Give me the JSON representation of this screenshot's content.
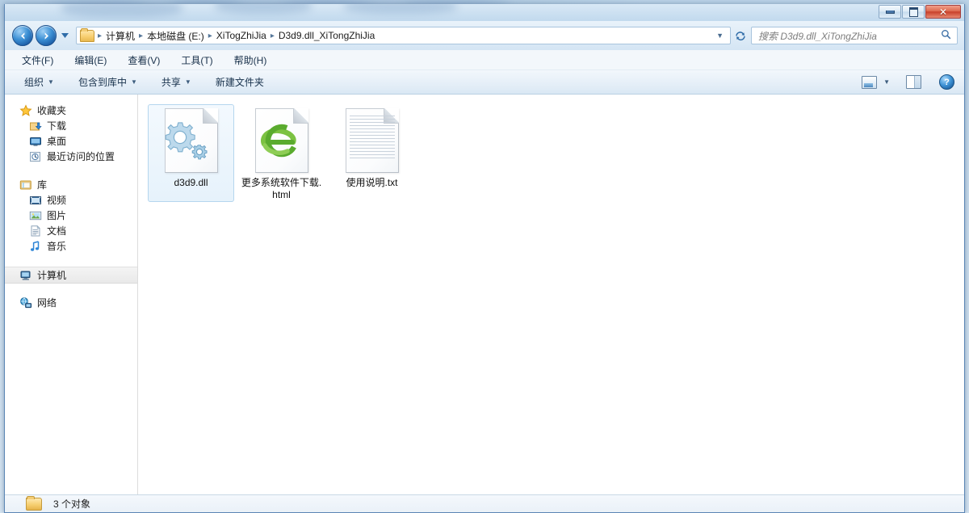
{
  "window": {
    "buttons": {
      "minimize": "minimize-button",
      "maximize": "maximize-button",
      "close": "✕"
    }
  },
  "nav": {
    "back_title": "后退",
    "forward_title": "前进",
    "breadcrumb": [
      "计算机",
      "本地磁盘 (E:)",
      "XiTogZhiJia",
      "D3d9.dll_XiTongZhiJia"
    ],
    "separator": "▸",
    "caret": "▼",
    "refresh_icon": "↻"
  },
  "search": {
    "placeholder": "搜索 D3d9.dll_XiTongZhiJia",
    "icon": "⌕"
  },
  "menu": {
    "items": [
      {
        "label": "文件(F)"
      },
      {
        "label": "编辑(E)"
      },
      {
        "label": "查看(V)"
      },
      {
        "label": "工具(T)"
      },
      {
        "label": "帮助(H)"
      }
    ]
  },
  "toolbar": {
    "items": [
      {
        "label": "组织",
        "caret": "▼"
      },
      {
        "label": "包含到库中",
        "caret": "▼"
      },
      {
        "label": "共享",
        "caret": "▼"
      },
      {
        "label": "新建文件夹",
        "caret": ""
      }
    ],
    "view_caret": "▼",
    "help_glyph": "?"
  },
  "sidebar": {
    "groups": [
      {
        "header": {
          "label": "收藏夹",
          "icon": "star-icon"
        },
        "items": [
          {
            "label": "下载",
            "icon": "downloads-icon"
          },
          {
            "label": "桌面",
            "icon": "desktop-icon"
          },
          {
            "label": "最近访问的位置",
            "icon": "recent-places-icon"
          }
        ]
      },
      {
        "header": {
          "label": "库",
          "icon": "libraries-icon"
        },
        "items": [
          {
            "label": "视频",
            "icon": "videos-icon"
          },
          {
            "label": "图片",
            "icon": "pictures-icon"
          },
          {
            "label": "文档",
            "icon": "documents-icon"
          },
          {
            "label": "音乐",
            "icon": "music-icon"
          }
        ]
      },
      {
        "header": {
          "label": "计算机",
          "icon": "computer-icon",
          "selected": true
        },
        "items": []
      },
      {
        "header": {
          "label": "网络",
          "icon": "network-icon"
        },
        "items": []
      }
    ]
  },
  "files": [
    {
      "name": "d3d9.dll",
      "icon": "dll-gears-icon",
      "selected": true
    },
    {
      "name": "更多系统软件下载.html",
      "icon": "ie-browser-icon",
      "selected": false
    },
    {
      "name": "使用说明.txt",
      "icon": "text-document-icon",
      "selected": false
    }
  ],
  "status": {
    "text": "3 个对象",
    "icon": "folder-icon"
  },
  "colors": {
    "accent": "#3b8fd4",
    "selection_fill": "#e6f2fb",
    "selection_border": "#b5d6ee",
    "close_red": "#c8402a"
  }
}
